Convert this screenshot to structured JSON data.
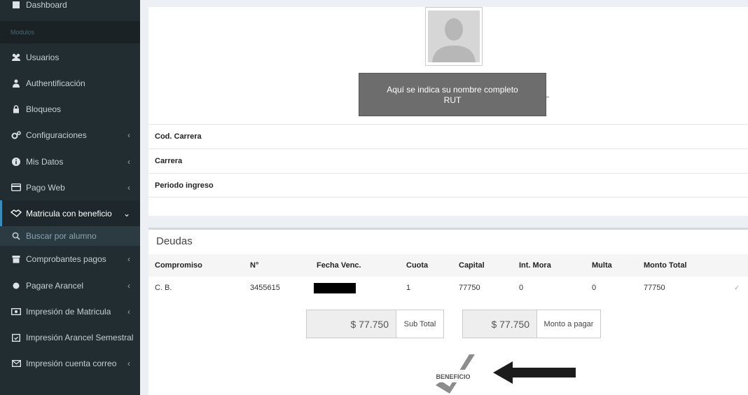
{
  "sidebar": {
    "dashboard": "Dashboard",
    "section_header": "Modulos",
    "items": [
      {
        "label": "Usuarios",
        "icon": "users-icon"
      },
      {
        "label": "Authentificación",
        "icon": "user-icon"
      },
      {
        "label": "Bloqueos",
        "icon": "lock-icon"
      },
      {
        "label": "Configuraciones",
        "icon": "cogs-icon"
      },
      {
        "label": "Mis Datos",
        "icon": "info-icon"
      },
      {
        "label": "Pago Web",
        "icon": "credit-card-icon"
      },
      {
        "label": "Matricula con beneficio",
        "icon": "handshake-icon"
      },
      {
        "label": "Buscar por alumno",
        "icon": "search-icon"
      },
      {
        "label": "Comprobantes pagos",
        "icon": "archive-icon"
      },
      {
        "label": "Pagare Arancel",
        "icon": "circle-icon"
      },
      {
        "label": "Impresión de Matricula",
        "icon": "money-icon"
      },
      {
        "label": "Impresión Arancel Semestral",
        "icon": "calendar-check-icon"
      },
      {
        "label": "Impresión cuenta correo",
        "icon": "envelope-icon"
      }
    ]
  },
  "profile": {
    "tooltip_line1": "Aquí se indica su nombre completo",
    "tooltip_line2": "RUT"
  },
  "info": {
    "cod_carrera": "Cod. Carrera",
    "carrera": "Carrera",
    "periodo_ingreso": "Periodo ingreso"
  },
  "deudas": {
    "title": "Deudas",
    "headers": [
      "Compromiso",
      "N°",
      "Fecha Venc.",
      "Cuota",
      "Capital",
      "Int. Mora",
      "Multa",
      "Monto Total"
    ],
    "row": {
      "compromiso": "C. B.",
      "numero": "3455615",
      "cuota": "1",
      "capital": "77750",
      "int_mora": "0",
      "multa": "0",
      "monto_total": "77750",
      "check": "✓"
    },
    "subtotal_value": "$ 77.750",
    "subtotal_label": "Sub Total",
    "monto_value": "$ 77.750",
    "monto_label": "Monto a pagar",
    "beneficio_label": "BENEFICIO"
  }
}
